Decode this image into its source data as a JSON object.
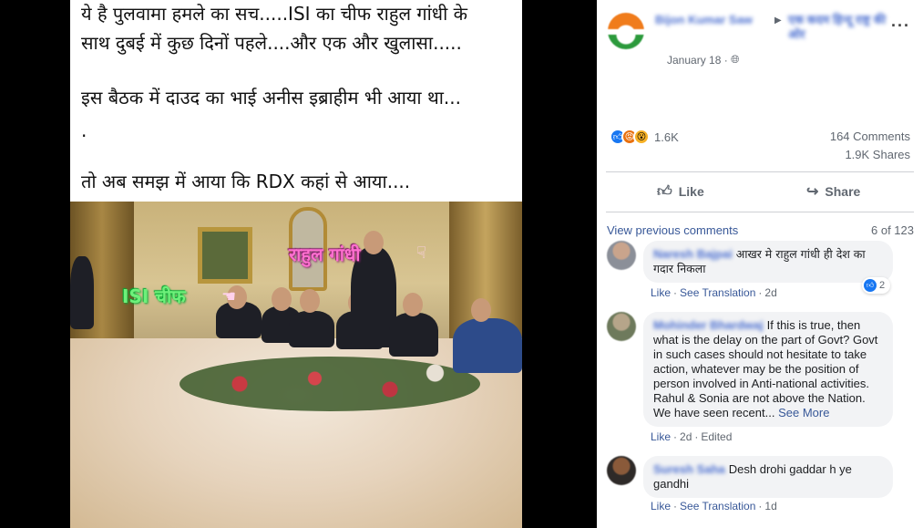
{
  "post_image": {
    "hindi_lines": [
      "ये है पुलवामा हमले का सच.....ISI का चीफ राहुल गांधी के",
      "साथ दुबई में कुछ दिनों पहले....और एक और खुलासा.....",
      "इस बैठक में दाउद का भाई अनीस इब्राहीम भी आया था...",
      ".",
      "तो अब समझ में आया कि RDX कहां से आया...."
    ],
    "label_isi": "ISI चीफ",
    "label_rahul": "राहुल गांधी"
  },
  "post": {
    "author": "Bijon Kumar Saw",
    "group": "एक कदम हिन्दू राष्ट्र की ओर",
    "date": "January 18 ·",
    "reaction_count": "1.6K",
    "comments_count": "164 Comments",
    "shares_count": "1.9K Shares",
    "like_label": "Like",
    "share_label": "Share"
  },
  "comments_section": {
    "view_previous": "View previous comments",
    "pager": "6 of 123",
    "comments": [
      {
        "name": "Naresh Bajpai",
        "text": "आखर मे राहुल गांधी ही देश का गदार निकला",
        "like": "Like",
        "see_translation": "See Translation",
        "time": "2d",
        "reaction_count": "2"
      },
      {
        "name": "Mohinder Bhardwaj",
        "text": "If this is true, then what is the delay on the part of Govt? Govt in such cases should not hesitate to take action, whatever may be the position of person involved in Anti-national activities. Rahul & Sonia are not above the Nation. We have seen recent...",
        "see_more": "See More",
        "like": "Like",
        "time": "2d",
        "edited": "Edited"
      },
      {
        "name": "Suresh Saha",
        "text": "Desh drohi gaddar h ye gandhi",
        "like": "Like",
        "see_translation": "See Translation",
        "time": "1d"
      }
    ]
  },
  "colors": {
    "link": "#385898",
    "secondary_text": "#606770",
    "bubble_bg": "#f2f3f5",
    "like_blue": "#1877f2"
  },
  "icons": [
    "more-icon",
    "globe-icon",
    "like-icon",
    "share-icon",
    "arrow-icon"
  ]
}
